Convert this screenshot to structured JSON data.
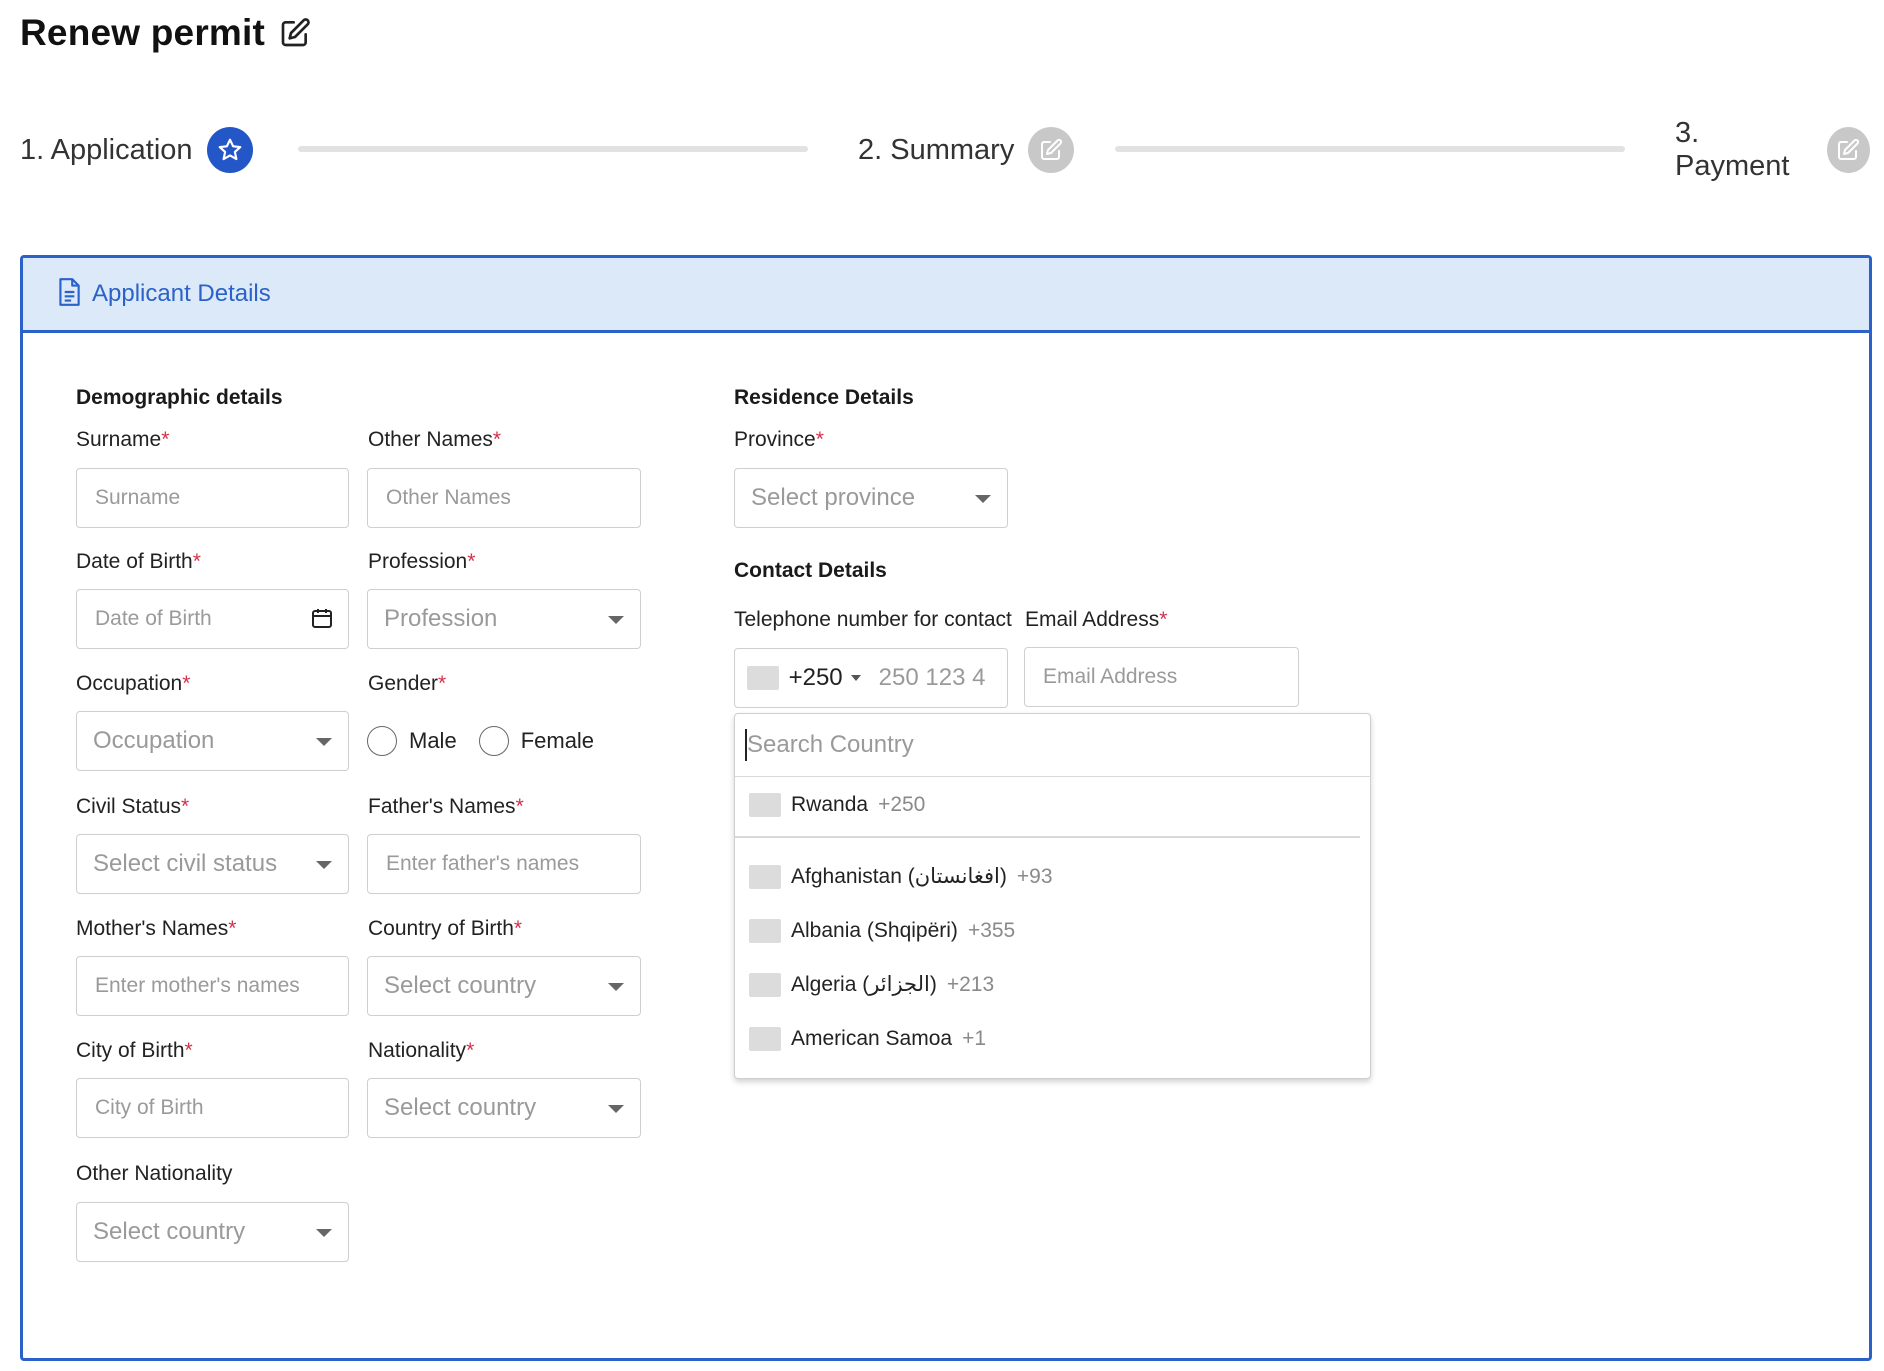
{
  "page": {
    "title": "Renew permit",
    "edit_icon": "edit-icon"
  },
  "stepper": {
    "steps": [
      {
        "label": "1. Application",
        "icon": "star-icon",
        "state": "active"
      },
      {
        "label": "2. Summary",
        "icon": "edit-icon",
        "state": "inactive"
      },
      {
        "label": "3. Payment",
        "icon": "edit-icon",
        "state": "inactive"
      }
    ]
  },
  "card": {
    "header": "Applicant Details",
    "header_icon": "document-icon"
  },
  "demographic": {
    "title": "Demographic details",
    "surname": {
      "label": "Surname",
      "required": "*",
      "placeholder": "Surname"
    },
    "other_names": {
      "label": "Other Names",
      "required": "*",
      "placeholder": "Other Names"
    },
    "dob": {
      "label": "Date of Birth",
      "required": "*",
      "placeholder": "Date of Birth"
    },
    "profession": {
      "label": "Profession",
      "required": "*",
      "placeholder": "Profession"
    },
    "occupation": {
      "label": "Occupation",
      "required": "*",
      "placeholder": "Occupation"
    },
    "gender": {
      "label": "Gender",
      "required": "*",
      "options": [
        "Male",
        "Female"
      ]
    },
    "civil_status": {
      "label": "Civil Status",
      "required": "*",
      "placeholder": "Select civil status"
    },
    "fathers_names": {
      "label": "Father's Names",
      "required": "*",
      "placeholder": "Enter father's names"
    },
    "mothers_names": {
      "label": "Mother's Names",
      "required": "*",
      "placeholder": "Enter mother's names"
    },
    "country_of_birth": {
      "label": "Country of Birth",
      "required": "*",
      "placeholder": "Select country"
    },
    "city_of_birth": {
      "label": "City of Birth",
      "required": "*",
      "placeholder": "City of Birth"
    },
    "nationality": {
      "label": "Nationality",
      "required": "*",
      "placeholder": "Select country"
    },
    "other_nationality": {
      "label": "Other Nationality",
      "placeholder": "Select country"
    }
  },
  "residence": {
    "title": "Residence Details",
    "province": {
      "label": "Province",
      "required": "*",
      "placeholder": "Select province"
    }
  },
  "contact": {
    "title": "Contact Details",
    "phone": {
      "label": "Telephone number for contact",
      "dial_code": "+250",
      "placeholder": "250 123 4"
    },
    "email": {
      "label": "Email Address",
      "required": "*",
      "placeholder": "Email Address"
    }
  },
  "country_dropdown": {
    "search_placeholder": "Search Country",
    "preferred": [
      {
        "name": "Rwanda",
        "code": "+250"
      }
    ],
    "countries": [
      {
        "name": "Afghanistan (‫افغانستان‬‎)",
        "code": "+93"
      },
      {
        "name": "Albania (Shqipëri)",
        "code": "+355"
      },
      {
        "name": "Algeria (‫الجزائر‬‎)",
        "code": "+213"
      },
      {
        "name": "American Samoa",
        "code": "+1"
      }
    ]
  },
  "colors": {
    "primary": "#2a62c9",
    "header_bg": "#dce9f8",
    "required": "#d5304a",
    "inactive_step": "#c8c8c8"
  }
}
